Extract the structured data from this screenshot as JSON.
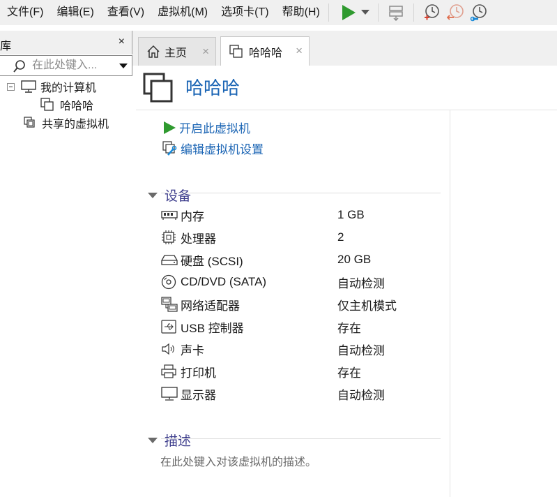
{
  "menu": [
    "文件(F)",
    "编辑(E)",
    "查看(V)",
    "虚拟机(M)",
    "选项卡(T)",
    "帮助(H)"
  ],
  "toolbar": {
    "icons": [
      "play-icon",
      "dropdown-arrow-icon",
      "send-keys-icon",
      "snapshot-icon",
      "revert-snapshot-icon",
      "manage-snapshots-icon"
    ],
    "colors": {
      "play": "#2f9a2f",
      "snapshot_accent": "#d8412f"
    }
  },
  "library": {
    "title": "库",
    "close": "×",
    "search_placeholder": "在此处键入...",
    "tree": {
      "root": "我的计算机",
      "child": "哈哈哈",
      "shared": "共享的虚拟机"
    }
  },
  "tabs": [
    {
      "label": "主页",
      "icon": "home-icon"
    },
    {
      "label": "哈哈哈",
      "icon": "vm-icon"
    }
  ],
  "tab_close": "×",
  "vm": {
    "title": "哈哈哈",
    "actions": {
      "power_on": "开启此虚拟机",
      "edit_settings": "编辑虚拟机设置"
    },
    "devices_title": "设备",
    "devices": [
      {
        "name": "内存",
        "value": "1 GB",
        "icon": "memory-icon"
      },
      {
        "name": "处理器",
        "value": "2",
        "icon": "processor-icon"
      },
      {
        "name": "硬盘 (SCSI)",
        "value": "20 GB",
        "icon": "hard-disk-icon"
      },
      {
        "name": "CD/DVD (SATA)",
        "value": "自动检测",
        "icon": "cd-dvd-icon"
      },
      {
        "name": "网络适配器",
        "value": "仅主机模式",
        "icon": "network-adapter-icon"
      },
      {
        "name": "USB 控制器",
        "value": "存在",
        "icon": "usb-icon"
      },
      {
        "name": "声卡",
        "value": "自动检测",
        "icon": "sound-card-icon"
      },
      {
        "name": "打印机",
        "value": "存在",
        "icon": "printer-icon"
      },
      {
        "name": "显示器",
        "value": "自动检测",
        "icon": "display-icon"
      }
    ],
    "description_title": "描述",
    "description_placeholder": "在此处键入对该虚拟机的描述。"
  }
}
